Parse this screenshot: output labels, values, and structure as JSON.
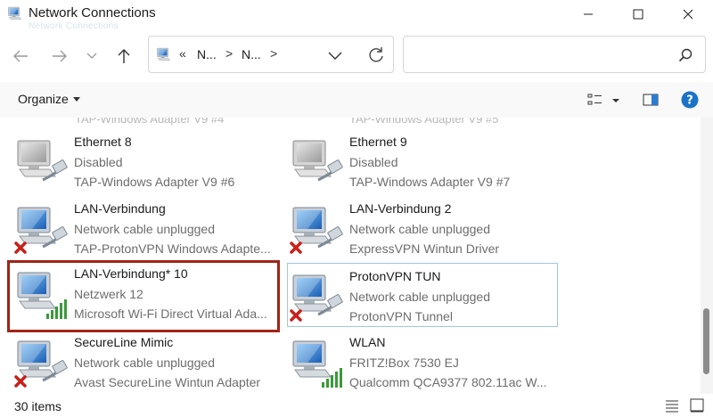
{
  "window": {
    "title": "Network Connections",
    "title_ghost": "Network Connections"
  },
  "address": {
    "prefix": "«",
    "crumbs": [
      "N...",
      "N..."
    ],
    "separator": ">"
  },
  "search": {
    "placeholder": ""
  },
  "toolbar": {
    "organize_label": "Organize"
  },
  "ghost_row": [
    "TAP-Windows Adapter V9 #4",
    "TAP-Windows Adapter V9 #5"
  ],
  "adapters": [
    {
      "name": "Ethernet 8",
      "status": "Disabled",
      "device": "TAP-Windows Adapter V9 #6",
      "icon": "ethernet-disabled"
    },
    {
      "name": "Ethernet 9",
      "status": "Disabled",
      "device": "TAP-Windows Adapter V9 #7",
      "icon": "ethernet-disabled"
    },
    {
      "name": "LAN-Verbindung",
      "status": "Network cable unplugged",
      "device": "TAP-ProtonVPN Windows Adapte...",
      "icon": "ethernet-unplugged"
    },
    {
      "name": "LAN-Verbindung 2",
      "status": "Network cable unplugged",
      "device": "ExpressVPN Wintun Driver",
      "icon": "ethernet-unplugged"
    },
    {
      "name": "LAN-Verbindung* 10",
      "status": "Netzwerk 12",
      "device": "Microsoft Wi-Fi Direct Virtual Ada...",
      "icon": "wifi-connected"
    },
    {
      "name": "ProtonVPN TUN",
      "status": "Network cable unplugged",
      "device": "ProtonVPN Tunnel",
      "icon": "ethernet-unplugged"
    },
    {
      "name": "SecureLine Mimic",
      "status": "Network cable unplugged",
      "device": "Avast SecureLine Wintun Adapter",
      "icon": "ethernet-unplugged"
    },
    {
      "name": "WLAN",
      "status": "FRITZ!Box 7530 EJ",
      "device": "Qualcomm QCA9377 802.11ac W...",
      "icon": "wifi-connected"
    }
  ],
  "statusbar": {
    "item_count": "30 items"
  },
  "colors": {
    "highlight_border": "#a02418",
    "focus_border": "#9ec6ea",
    "help_blue": "#1a73c9",
    "unplugged_red": "#c8201a",
    "signal_green": "#3a9a3a"
  }
}
